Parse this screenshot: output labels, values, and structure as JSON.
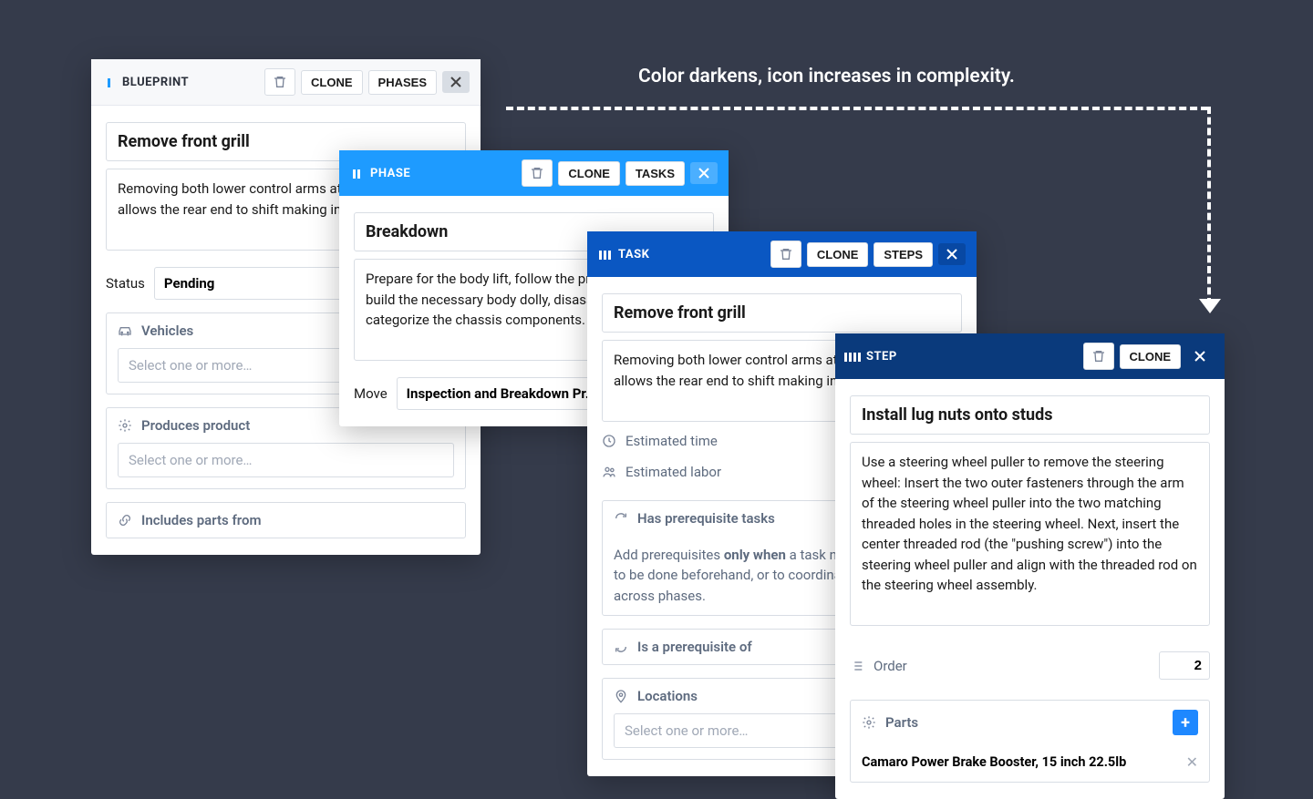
{
  "annotation": "Color darkens, icon increases in complexity.",
  "blueprint": {
    "label": "BLUEPRINT",
    "clone": "CLONE",
    "phases": "PHASES",
    "title": "Remove front grill",
    "desc": "Removing both lower control arms at the same time allows the rear end to shift making installation difficult.",
    "status_label": "Status",
    "status_value": "Pending",
    "vehicles_label": "Vehicles",
    "vehicles_placeholder": "Select one or more…",
    "produces_label": "Produces product",
    "produces_placeholder": "Select one or more…",
    "includes_label": "Includes parts from"
  },
  "phase": {
    "label": "PHASE",
    "clone": "CLONE",
    "tasks": "TASKS",
    "title": "Breakdown",
    "desc": "Prepare for the body lift, follow the prep procedure and build the necessary body dolly, disassemble and categorize the chassis components.",
    "move_label": "Move",
    "move_value": "Inspection and Breakdown Pr…"
  },
  "task": {
    "label": "TASK",
    "clone": "CLONE",
    "steps": "STEPS",
    "title": "Remove front grill",
    "desc": "Removing both lower control arms at the same time allows the rear end to shift making installation difficult.",
    "est_time": "Estimated time",
    "est_labor": "Estimated labor",
    "has_prereq": "Has prerequisite tasks",
    "hint_pre": "Add prerequisites ",
    "hint_bold": "only when",
    "hint_post": " a task needs other tasks to be done beforehand, or to coordinate dependencies across phases.",
    "is_prereq": "Is a prerequisite of",
    "locations": "Locations",
    "locations_placeholder": "Select one or more…"
  },
  "step": {
    "label": "STEP",
    "clone": "CLONE",
    "title": "Install lug nuts onto studs",
    "desc": "Use a steering wheel puller to remove the steering wheel: Insert the two outer fasteners through the arm of the steering wheel puller into the two matching threaded holes in the steering wheel. Next, insert the center threaded rod (the \"pushing screw\") into the steering wheel puller and align with the threaded rod on the steering wheel assembly.",
    "order_label": "Order",
    "order_value": "2",
    "parts_label": "Parts",
    "part1": "Camaro Power Brake Booster, 15 inch 22.5lb"
  }
}
